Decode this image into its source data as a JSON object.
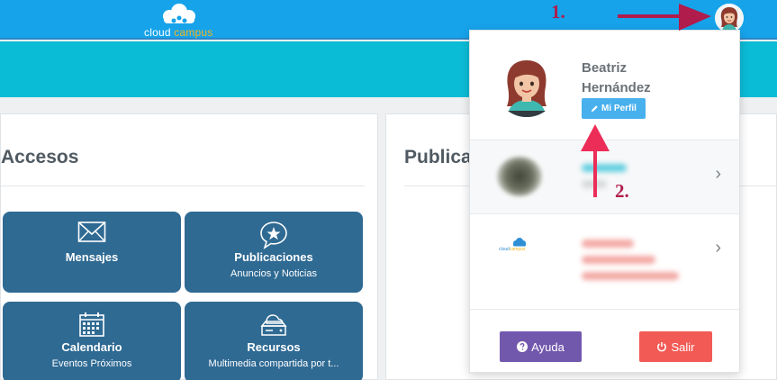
{
  "header": {
    "logo_word1": "cloud",
    "logo_word2": "campus"
  },
  "accesos": {
    "title": "Accesos",
    "tiles": [
      {
        "title": "Mensajes",
        "subtitle": "",
        "icon": "envelope-icon"
      },
      {
        "title": "Publicaciones",
        "subtitle": "Anuncios y Noticias",
        "icon": "star-speech-bubble-icon"
      },
      {
        "title": "Calendario",
        "subtitle": "Eventos Próximos",
        "icon": "calendar-icon"
      },
      {
        "title": "Recursos",
        "subtitle": "Multimedia compartida por t...",
        "icon": "cloud-drive-icon"
      }
    ]
  },
  "publicaciones": {
    "title": "Publicac"
  },
  "profile_menu": {
    "name_first": "Beatriz",
    "name_last": "Hernández",
    "perfil_label": "Mi Perfil",
    "ayuda_label": "Ayuda",
    "salir_label": "Salir",
    "mini_logo_word1": "cloud",
    "mini_logo_word2": "campus"
  },
  "annotations": {
    "step1": "1.",
    "step2": "2."
  },
  "colors": {
    "topbar": "#16a3ea",
    "banner": "#0bbcd6",
    "tile": "#2f6a93",
    "perfil_button": "#48b0ed",
    "ayuda_button": "#7258ad",
    "salir_button": "#f25a55",
    "annotation": "#b01c4c",
    "logo_accent": "#f5b51c"
  }
}
